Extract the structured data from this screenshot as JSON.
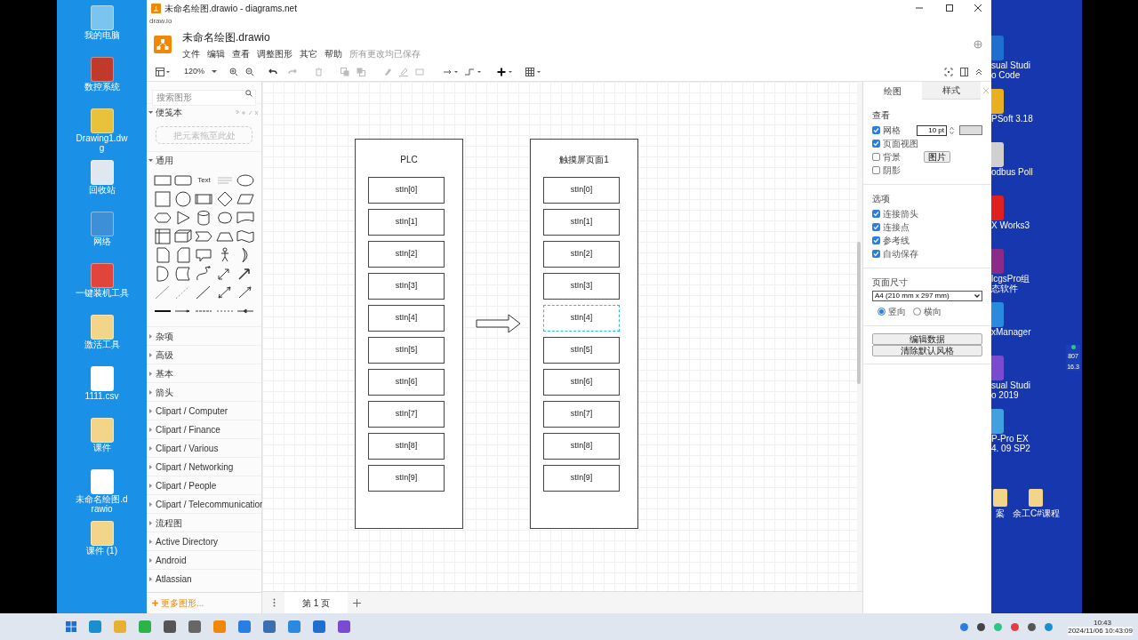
{
  "window": {
    "title": "未命名绘图.drawio - diagrams.net"
  },
  "address": "draw.io",
  "app": {
    "file_name": "未命名绘图.drawio",
    "menu": [
      "文件",
      "编辑",
      "查看",
      "调整图形",
      "其它",
      "帮助"
    ],
    "save_status": "所有更改均已保存"
  },
  "toolbar": {
    "zoom": "120%"
  },
  "sidebar": {
    "search_placeholder": "搜索图形",
    "scratchpad": {
      "title": "便笺本",
      "expanded": true,
      "drop_hint": "把元素拖至此处"
    },
    "general": {
      "title": "通用",
      "expanded": true,
      "text_shape": "Text"
    },
    "libraries": [
      {
        "label": "杂项",
        "expanded": false
      },
      {
        "label": "高级",
        "expanded": false
      },
      {
        "label": "基本",
        "expanded": false
      },
      {
        "label": "箭头",
        "expanded": false
      },
      {
        "label": "Clipart / Computer",
        "expanded": false
      },
      {
        "label": "Clipart / Finance",
        "expanded": false
      },
      {
        "label": "Clipart / Various",
        "expanded": false
      },
      {
        "label": "Clipart / Networking",
        "expanded": false
      },
      {
        "label": "Clipart / People",
        "expanded": false
      },
      {
        "label": "Clipart / Telecommunication",
        "expanded": false
      },
      {
        "label": "流程图",
        "expanded": false
      },
      {
        "label": "Active Directory",
        "expanded": false
      },
      {
        "label": "Android",
        "expanded": false
      },
      {
        "label": "Atlassian",
        "expanded": false
      }
    ],
    "more_shapes": "更多图形..."
  },
  "diagram": {
    "containers": [
      {
        "title": "PLC",
        "items": [
          {
            "label": "stIn[0]",
            "selected": false
          },
          {
            "label": "stIn[1]",
            "selected": false
          },
          {
            "label": "stIn[2]",
            "selected": false
          },
          {
            "label": "stIn[3]",
            "selected": false
          },
          {
            "label": "stIn[4]",
            "selected": false
          },
          {
            "label": "stIn[5]",
            "selected": false
          },
          {
            "label": "stIn[6]",
            "selected": false
          },
          {
            "label": "stIn[7]",
            "selected": false
          },
          {
            "label": "stIn[8]",
            "selected": false
          },
          {
            "label": "stIn[9]",
            "selected": false
          }
        ]
      },
      {
        "title": "触摸屏页面1",
        "items": [
          {
            "label": "stIn[0]",
            "selected": false
          },
          {
            "label": "stIn[1]",
            "selected": false
          },
          {
            "label": "stIn[2]",
            "selected": false
          },
          {
            "label": "stIn[3]",
            "selected": false
          },
          {
            "label": "stIn[4]",
            "selected": true
          },
          {
            "label": "stIn[5]",
            "selected": false
          },
          {
            "label": "stIn[6]",
            "selected": false
          },
          {
            "label": "stIn[7]",
            "selected": false
          },
          {
            "label": "stIn[8]",
            "selected": false
          },
          {
            "label": "stIn[9]",
            "selected": false
          }
        ]
      }
    ]
  },
  "format_panel": {
    "tabs": [
      {
        "label": "绘图",
        "selected": true
      },
      {
        "label": "样式",
        "selected": false
      }
    ],
    "view_heading": "查看",
    "view_options": [
      {
        "label": "网格",
        "checked": true
      },
      {
        "label": "页面视图",
        "checked": true
      },
      {
        "label": "背景",
        "checked": false
      },
      {
        "label": "阴影",
        "checked": false
      }
    ],
    "grid_size": "10 pt",
    "image_button": "图片",
    "options_heading": "选项",
    "options": [
      {
        "label": "连接箭头",
        "checked": true
      },
      {
        "label": "连接点",
        "checked": true
      },
      {
        "label": "参考线",
        "checked": true
      },
      {
        "label": "自动保存",
        "checked": true
      }
    ],
    "paper_heading": "页面尺寸",
    "paper_size": "A4 (210 mm x 297 mm)",
    "orientation": [
      {
        "label": "竖向",
        "selected": true
      },
      {
        "label": "横向",
        "selected": false
      }
    ],
    "buttons": [
      "编辑数据",
      "清除默认风格"
    ]
  },
  "pages": [
    {
      "label": "第 1 页",
      "selected": true
    }
  ],
  "desktop": {
    "left_icons": [
      {
        "label": "我的电脑",
        "color": "#7cc4f0"
      },
      {
        "label": "数控系统",
        "color": "#c0392b"
      },
      {
        "label": "Drawing1.dwg",
        "color": "#e8c23a"
      },
      {
        "label": "回收站",
        "color": "#dfe8f0"
      },
      {
        "label": "网络",
        "color": "#3d8fd8"
      },
      {
        "label": "一键装机工具",
        "color": "#e0443a"
      },
      {
        "label": "激活工具",
        "color": "#f3d58a"
      },
      {
        "label": "1111.csv",
        "color": "#ffffff"
      },
      {
        "label": "课件",
        "color": "#f3d58a"
      },
      {
        "label": "未命名绘图.drawio",
        "color": "#ffffff"
      },
      {
        "label": "课件 (1)",
        "color": "#f3d58a"
      }
    ],
    "right_icons": [
      {
        "label": "sual Studi o Code",
        "color": "#1e6fd0"
      },
      {
        "label": "PSoft 3.18",
        "color": "#e8b020"
      },
      {
        "label": "odbus Poll",
        "color": "#d0d0d0"
      },
      {
        "label": "X Works3",
        "color": "#e02020"
      },
      {
        "label": "lcgsPro组态软件",
        "color": "#8a2b8a"
      },
      {
        "label": "xManager",
        "color": "#2a8ae0"
      },
      {
        "label": "sual Studi o 2019",
        "color": "#7a4ad0"
      },
      {
        "label": "P-Pro EX 4. 09 SP2",
        "color": "#40a0e0"
      }
    ],
    "bottom_icons": [
      {
        "label": "案",
        "color": "#f3d58a"
      },
      {
        "label": "余工C#课程",
        "color": "#f3d58a"
      }
    ],
    "net_speed": [
      "807",
      "16.3"
    ]
  },
  "taskbar": {
    "time": "10:43",
    "timestamp": "2024/11/06 10:43:09"
  }
}
